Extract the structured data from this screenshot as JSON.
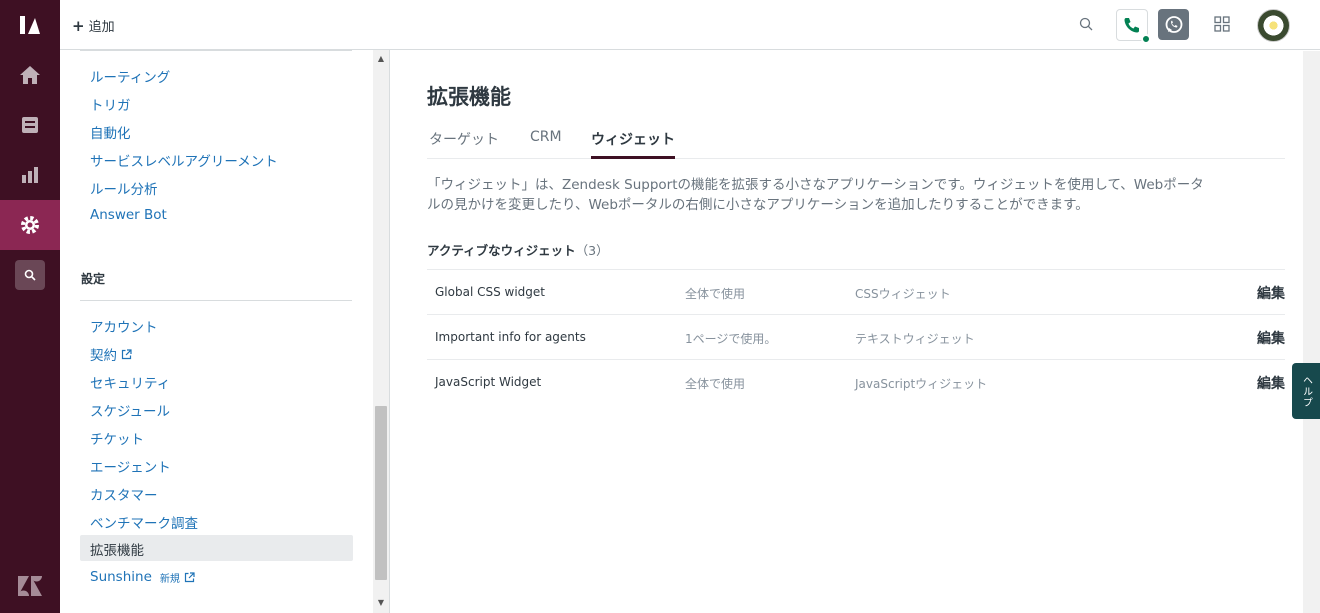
{
  "topbar": {
    "add_label": "追加",
    "icons": [
      "search-icon",
      "phone-icon",
      "whatsapp-icon",
      "apps-grid-icon",
      "avatar"
    ]
  },
  "rail": {
    "items": [
      "home-icon",
      "views-icon",
      "reporting-icon",
      "admin-gear-icon",
      "search-icon"
    ],
    "active": "admin-gear-icon",
    "accent": "#8b2753",
    "bg": "#3e1023"
  },
  "sidebar": {
    "business_rules": [
      {
        "label": "ルーティング"
      },
      {
        "label": "トリガ"
      },
      {
        "label": "自動化"
      },
      {
        "label": "サービスレベルアグリーメント"
      },
      {
        "label": "ルール分析"
      },
      {
        "label": "Answer Bot"
      }
    ],
    "settings_heading": "設定",
    "settings": [
      {
        "label": "アカウント"
      },
      {
        "label": "契約",
        "external": true
      },
      {
        "label": "セキュリティ"
      },
      {
        "label": "スケジュール"
      },
      {
        "label": "チケット"
      },
      {
        "label": "エージェント"
      },
      {
        "label": "カスタマー"
      },
      {
        "label": "ベンチマーク調査"
      },
      {
        "label": "拡張機能",
        "active": true
      },
      {
        "label": "Sunshine",
        "badge": "新規",
        "external": true
      }
    ]
  },
  "main": {
    "title": "拡張機能",
    "tabs": [
      {
        "label": "ターゲット"
      },
      {
        "label": "CRM"
      },
      {
        "label": "ウィジェット",
        "selected": true
      }
    ],
    "description": "「ウィジェット」は、Zendesk Supportの機能を拡張する小さなアプリケーションです。ウィジェットを使用して、Webポータルの見かけを変更したり、Webポータルの右側に小さなアプリケーションを追加したりすることができます。",
    "section_title": "アクティブなウィジェット",
    "section_count": "（3）",
    "widgets": [
      {
        "name": "Global CSS widget",
        "usage": "全体で使用",
        "type": "CSSウィジェット",
        "edit": "編集"
      },
      {
        "name": "Important info for agents",
        "usage": "1ページで使用。",
        "type": "テキストウィジェット",
        "edit": "編集"
      },
      {
        "name": "JavaScript Widget",
        "usage": "全体で使用",
        "type": "JavaScriptウィジェット",
        "edit": "編集"
      }
    ]
  },
  "help_tab": {
    "label": "ヘルプ"
  }
}
